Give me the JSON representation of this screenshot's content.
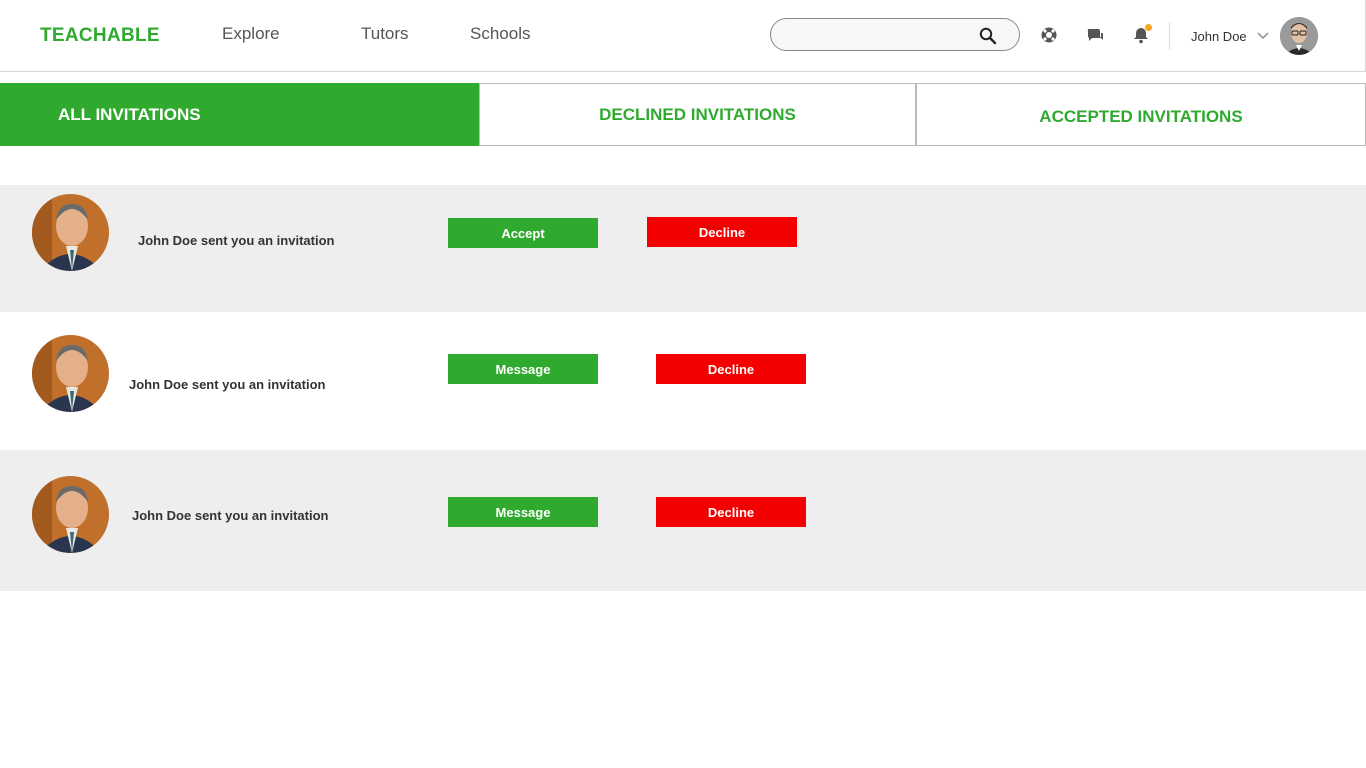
{
  "header": {
    "logo": "TEACHABLE",
    "nav": {
      "explore": "Explore",
      "tutors": "Tutors",
      "schools": "Schools"
    },
    "search": {
      "placeholder": ""
    },
    "icons": [
      "search-icon",
      "support-icon",
      "chat-icon",
      "bell-icon",
      "chevron-down-icon"
    ],
    "user_name": "John Doe"
  },
  "tabs": {
    "all": "ALL INVITATIONS",
    "declined": "DECLINED INVITATIONS",
    "accepted": "ACCEPTED INVITATIONS"
  },
  "invitations": [
    {
      "text": "John Doe sent you an invitation",
      "primary_label": "Accept",
      "secondary_label": "Decline"
    },
    {
      "text": "John Doe sent you an invitation",
      "primary_label": "Message",
      "secondary_label": "Decline"
    },
    {
      "text": "John Doe sent you an invitation",
      "primary_label": "Message",
      "secondary_label": "Decline"
    }
  ],
  "colors": {
    "brand_green": "#2faa2f",
    "decline_red": "#f50000",
    "row_alt_bg": "#eeeeee",
    "notification_dot": "#f5a623"
  }
}
